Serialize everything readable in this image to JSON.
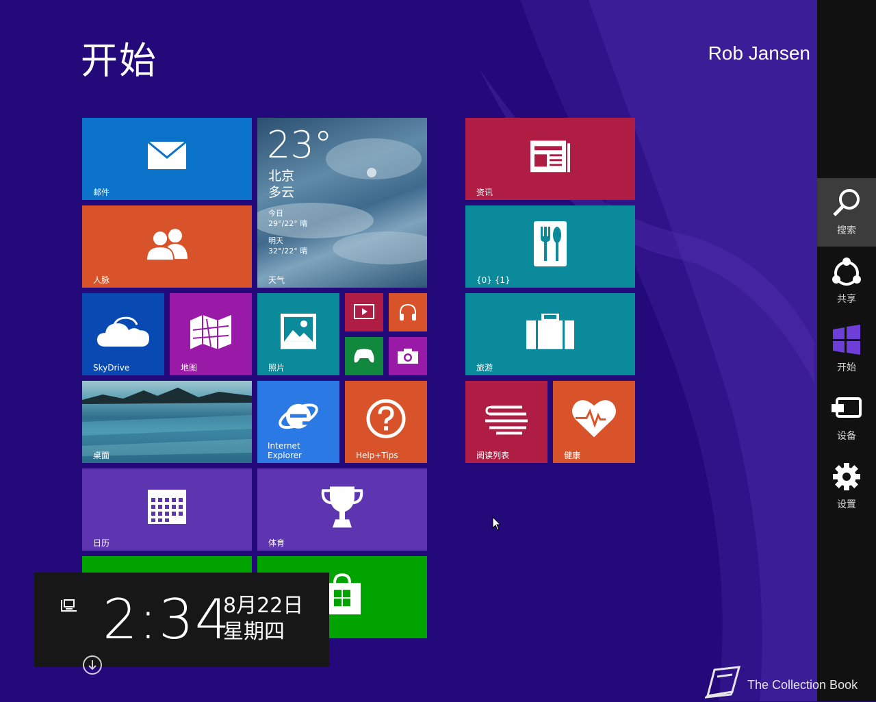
{
  "header": {
    "title": "开始",
    "user_name": "Rob Jansen"
  },
  "tiles": {
    "mail": "邮件",
    "weather": {
      "temp": "23°",
      "city": "北京",
      "condition": "多云",
      "today_label": "今日",
      "today_forecast": "29°/22° 晴",
      "tomorrow_label": "明天",
      "tomorrow_forecast": "32°/22° 晴",
      "label": "天气"
    },
    "news": "资讯",
    "people": "人脉",
    "food": "{0} {1}",
    "skydrive": "SkyDrive",
    "maps": "地图",
    "photos": "照片",
    "travel": "旅游",
    "desktop": "桌面",
    "ie": "Internet Explorer",
    "ie_line1": "Internet",
    "ie_line2": "Explorer",
    "help": "Help+Tips",
    "reading": "阅读列表",
    "health": "健康",
    "calendar": "日历",
    "sports": "体育"
  },
  "charms": {
    "search": "搜索",
    "share": "共享",
    "start": "开始",
    "devices": "设备",
    "settings": "设置"
  },
  "clock": {
    "time": "2:34",
    "date": "8月22日",
    "weekday": "星期四"
  },
  "watermark": "The Collection Book",
  "colors": {
    "background": "#24097a",
    "charm_bar": "#111111",
    "mail": "#0a72c9",
    "weather": "#3a6b8d",
    "news": "#b01d44",
    "people": "#d9532a",
    "food": "#0b8a9c",
    "skydrive": "#094ab2",
    "maps": "#9a1aa8",
    "photos": "#0b8a9c",
    "video": "#b01d44",
    "music": "#d9532a",
    "games": "#10893e",
    "camera": "#9a1aa8",
    "travel": "#0b8a9c",
    "ie": "#2a79e4",
    "help": "#d9532a",
    "reading": "#b01d44",
    "health": "#d9532a",
    "calendar": "#5e35b1",
    "sports": "#5e35b1",
    "finance": "#00a300",
    "store": "#00a300"
  },
  "icons": {
    "mail": "envelope-icon",
    "people": "people-icon",
    "news": "newspaper-icon",
    "food": "fork-spoon-icon",
    "skydrive": "cloud-icon",
    "maps": "map-icon",
    "photos": "picture-icon",
    "video": "video-icon",
    "music": "headphones-icon",
    "games": "gamepad-icon",
    "camera": "camera-icon",
    "travel": "suitcase-icon",
    "ie": "ie-logo-icon",
    "help": "question-icon",
    "reading": "reading-list-icon",
    "health": "heart-icon",
    "calendar": "calendar-icon",
    "sports": "trophy-icon",
    "finance": "chart-icon",
    "store": "store-bag-icon",
    "network": "network-icon",
    "scroll": "down-arrow-icon"
  }
}
